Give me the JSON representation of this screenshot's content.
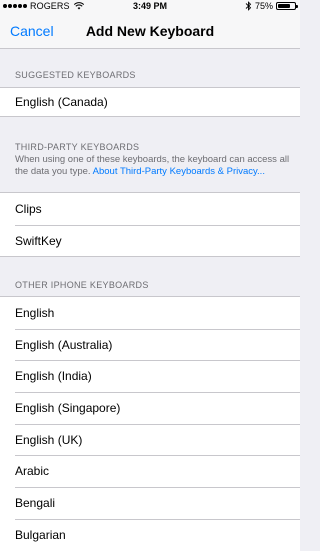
{
  "status_bar": {
    "carrier": "ROGERS",
    "time": "3:49 PM",
    "battery_percent": "75%",
    "battery_level": 0.75
  },
  "nav": {
    "cancel_label": "Cancel",
    "title": "Add New Keyboard"
  },
  "suggested": {
    "header": "SUGGESTED KEYBOARDS",
    "items": [
      "English (Canada)"
    ]
  },
  "third_party": {
    "header": "THIRD-PARTY KEYBOARDS",
    "footer_text": "When using one of these keyboards, the keyboard can access all the data you type. ",
    "footer_link": "About Third-Party Keyboards & Privacy...",
    "items": [
      "Clips",
      "SwiftKey"
    ]
  },
  "other": {
    "header": "OTHER IPHONE KEYBOARDS",
    "items": [
      "English",
      "English (Australia)",
      "English (India)",
      "English (Singapore)",
      "English (UK)",
      "Arabic",
      "Bengali",
      "Bulgarian"
    ]
  },
  "colors": {
    "accent": "#007aff",
    "background": "#efeff4",
    "separator": "#c8c7cc",
    "secondary_text": "#6d6d72"
  },
  "icons": [
    "wifi-icon",
    "bluetooth-icon",
    "battery-icon",
    "signal-icon"
  ]
}
